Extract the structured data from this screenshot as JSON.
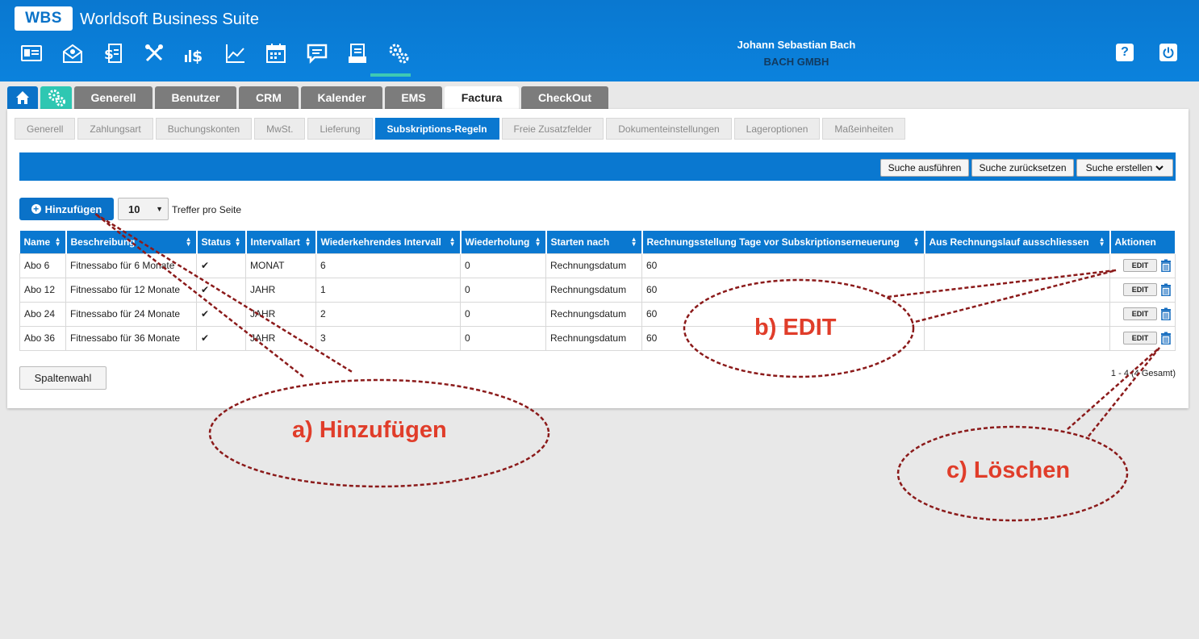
{
  "app": {
    "logo": "WBS",
    "title": "Worldsoft Business Suite"
  },
  "nav_icons": [
    "id-card-icon",
    "mail-icon",
    "invoice-dollar-icon",
    "tools-icon",
    "money-icon",
    "chart-icon",
    "calendar-icon",
    "chat-icon",
    "documents-icon",
    "settings-gears-icon"
  ],
  "user": {
    "name": "Johann Sebastian Bach",
    "company": "BACH GMBH"
  },
  "main_tabs": [
    "Generell",
    "Benutzer",
    "CRM",
    "Kalender",
    "EMS",
    "Factura",
    "CheckOut"
  ],
  "active_main_tab": "Factura",
  "sub_tabs": [
    "Generell",
    "Zahlungsart",
    "Buchungskonten",
    "MwSt.",
    "Lieferung",
    "Subskriptions-Regeln",
    "Freie Zusatzfelder",
    "Dokumenteinstellungen",
    "Lageroptionen",
    "Maßeinheiten"
  ],
  "active_sub_tab": "Subskriptions-Regeln",
  "toolbar": {
    "search": "Suche ausführen",
    "reset": "Suche zurücksetzen",
    "create": "Suche erstellen"
  },
  "add_button": "Hinzufügen",
  "page_size": "10",
  "per_page_label": "Treffer pro Seite",
  "table": {
    "columns": [
      "Name",
      "Beschreibung",
      "Status",
      "Intervallart",
      "Wiederkehrendes Intervall",
      "Wiederholung",
      "Starten nach",
      "Rechnungsstellung Tage vor Subskriptionserneuerung",
      "Aus Rechnungslauf ausschliessen",
      "Aktionen"
    ],
    "rows": [
      {
        "name": "Abo 6",
        "desc": "Fitnessabo für 6 Monate",
        "status": "✔",
        "type": "MONAT",
        "interval": "6",
        "repeat": "0",
        "start": "Rechnungsdatum",
        "days": "60",
        "exclude": "",
        "edit": "EDIT"
      },
      {
        "name": "Abo 12",
        "desc": "Fitnessabo für 12 Monate",
        "status": "✔",
        "type": "JAHR",
        "interval": "1",
        "repeat": "0",
        "start": "Rechnungsdatum",
        "days": "60",
        "exclude": "",
        "edit": "EDIT"
      },
      {
        "name": "Abo 24",
        "desc": "Fitnessabo für 24 Monate",
        "status": "✔",
        "type": "JAHR",
        "interval": "2",
        "repeat": "0",
        "start": "Rechnungsdatum",
        "days": "60",
        "exclude": "",
        "edit": "EDIT"
      },
      {
        "name": "Abo 36",
        "desc": "Fitnessabo für 36 Monate",
        "status": "✔",
        "type": "JAHR",
        "interval": "3",
        "repeat": "0",
        "start": "Rechnungsdatum",
        "days": "60",
        "exclude": "",
        "edit": "EDIT"
      }
    ]
  },
  "column_select": "Spaltenwahl",
  "pager_info": "1 - 4 (4 Gesamt)",
  "annotations": {
    "a": "a) Hinzufügen",
    "b": "b) EDIT",
    "c": "c) Löschen"
  },
  "colors": {
    "primary": "#0a78d0",
    "accent": "#2ec7b2",
    "annotation": "#8b1a1a",
    "annotation_text": "#e03d2a"
  }
}
